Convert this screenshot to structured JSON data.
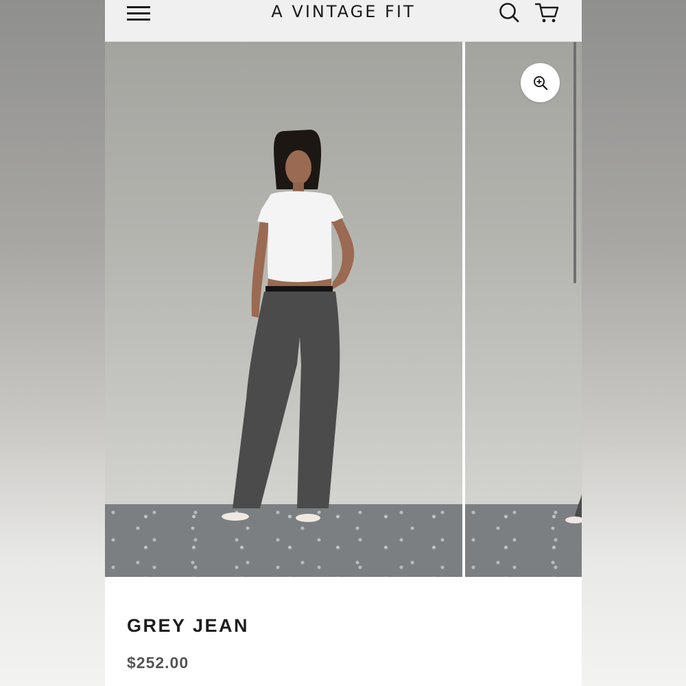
{
  "header": {
    "brand": "A VINTAGE FIT",
    "menu_icon": "hamburger-menu-icon",
    "search_icon": "search-icon",
    "cart_icon": "cart-icon"
  },
  "gallery": {
    "images": [
      {
        "description_icon": "product-photo",
        "alt": "Model wearing grey jeans, front view"
      },
      {
        "description_icon": "product-photo",
        "alt": "Model wearing grey jeans, alternate view"
      }
    ],
    "zoom_icon": "zoom-in-icon"
  },
  "product": {
    "title": "GREY JEAN",
    "price": "$252.00"
  },
  "colors": {
    "header_bg": "#f0f0f0",
    "text": "#1a1a1a",
    "price": "#555555"
  }
}
